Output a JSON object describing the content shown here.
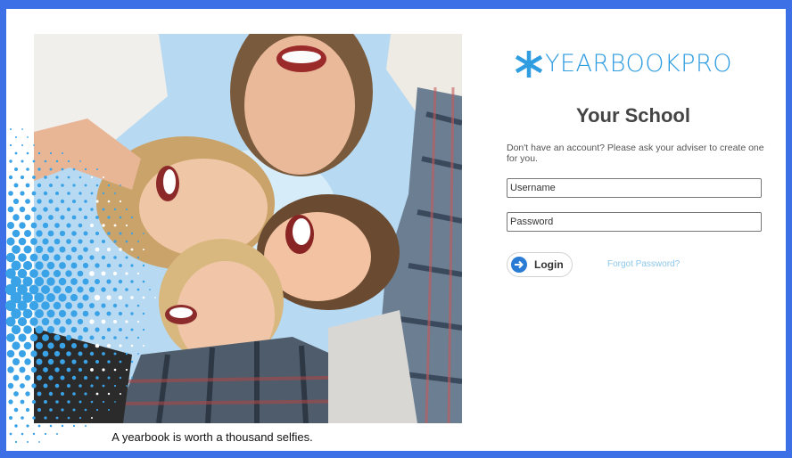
{
  "hero": {
    "caption": "A yearbook is worth a thousand selfies."
  },
  "brand": {
    "logo_text": "YEARBOOKPRO",
    "logo_icon": "asterisk-star-icon",
    "color": "#2f9de0",
    "frame_color": "#3d6fe6"
  },
  "login": {
    "school_name": "Your School",
    "account_note": "Don't have an account? Please ask your adviser to create one for you.",
    "username_placeholder": "Username",
    "password_placeholder": "Password",
    "login_label": "Login",
    "forgot_label": "Forgot Password?"
  }
}
